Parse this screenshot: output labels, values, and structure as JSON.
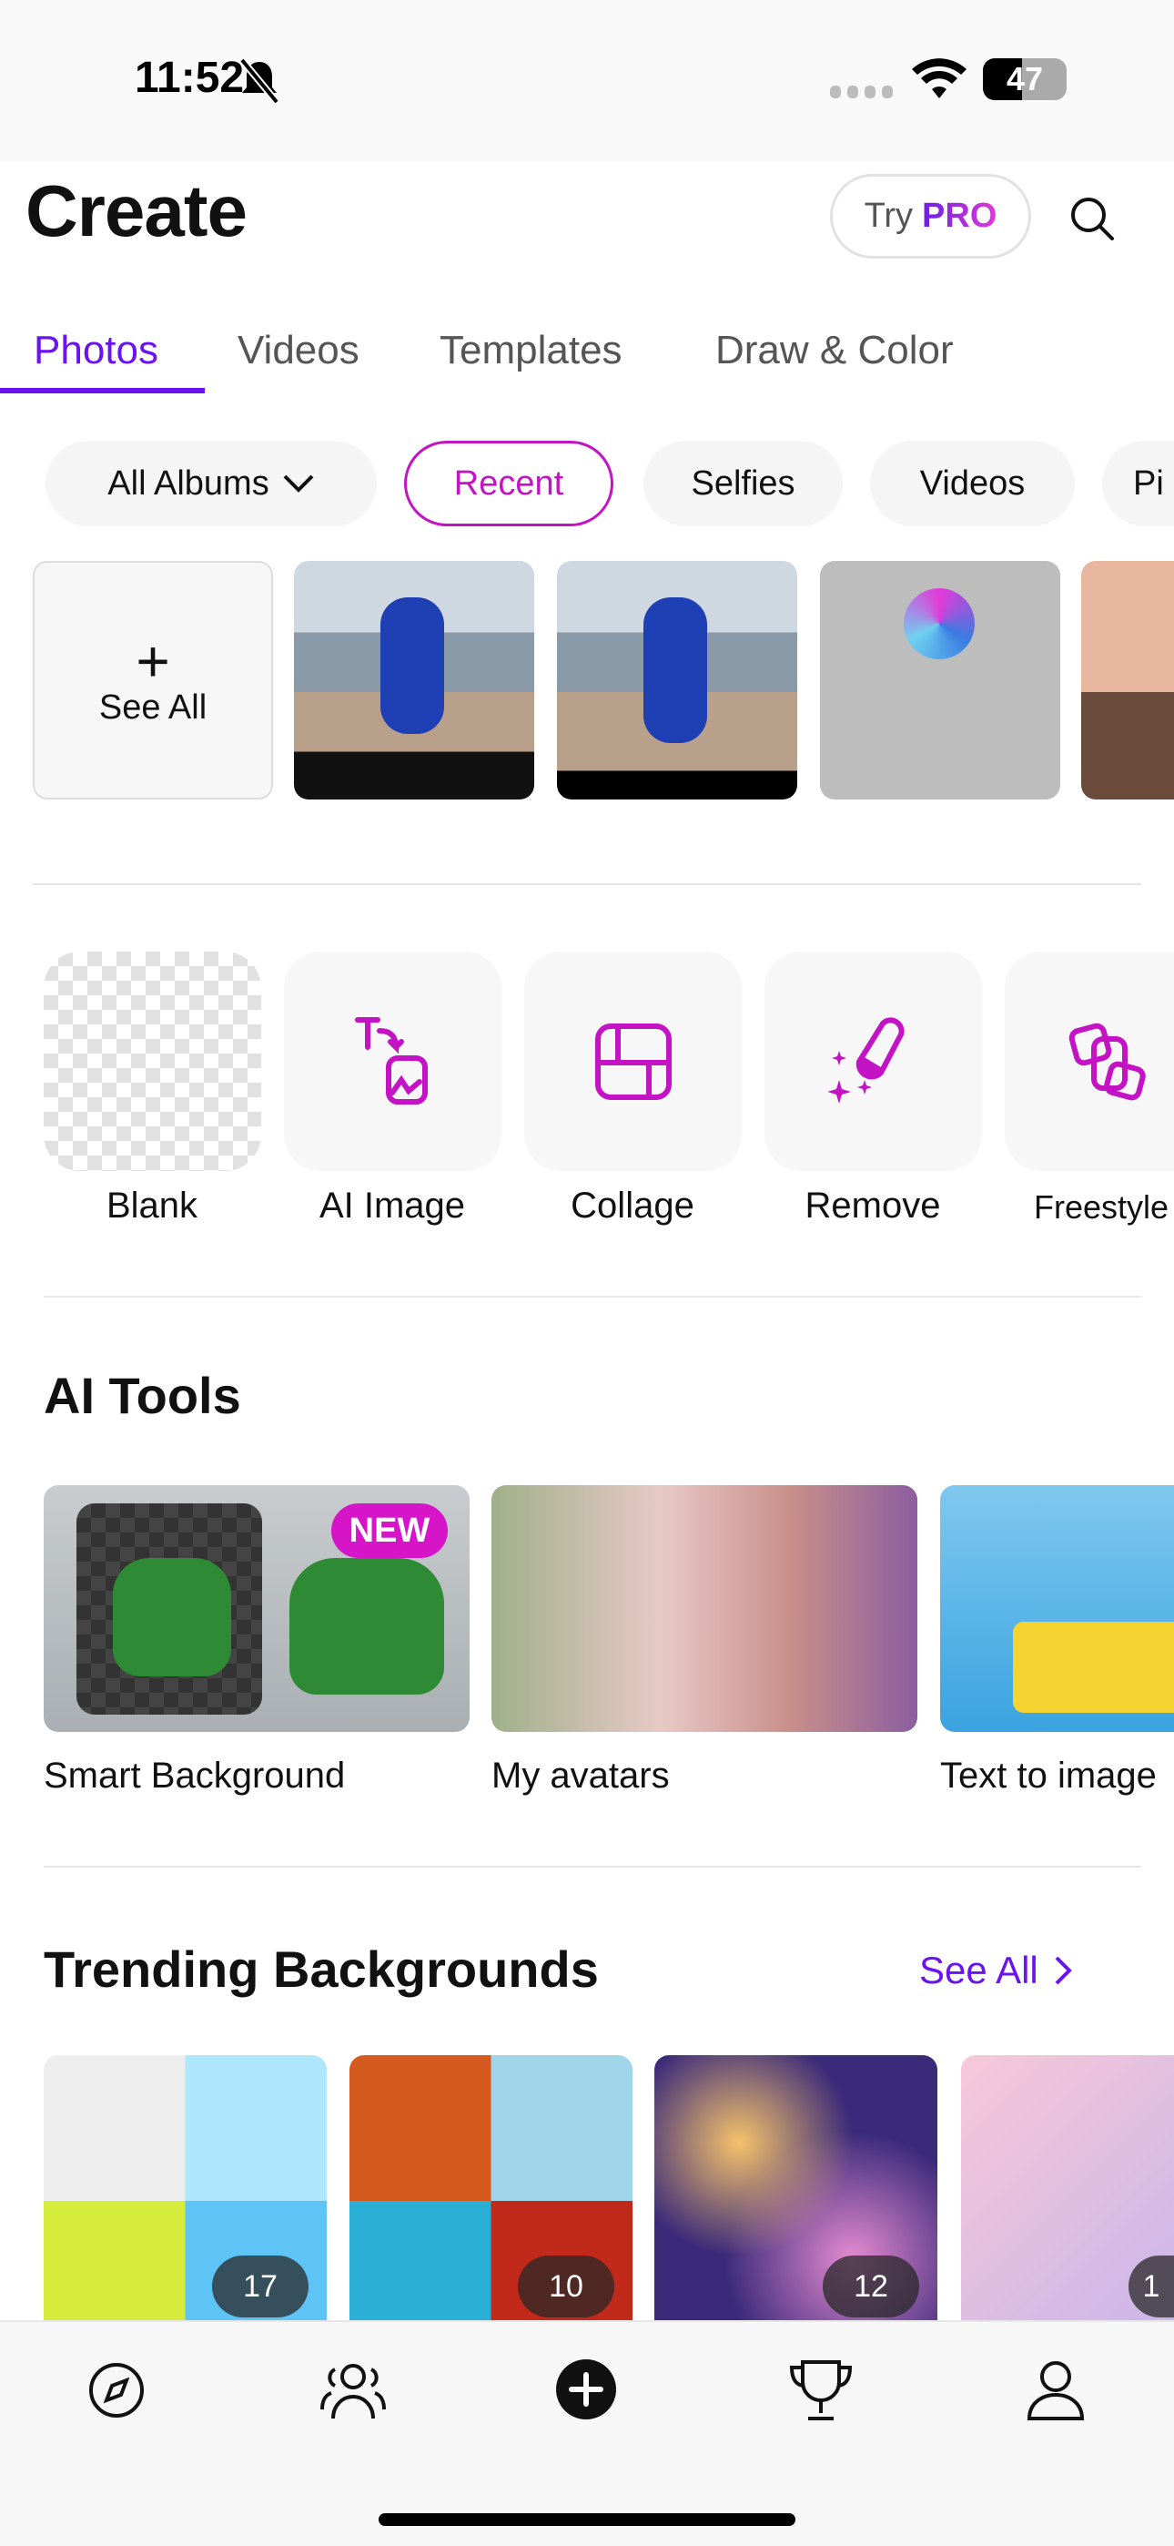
{
  "status": {
    "time": "11:52",
    "battery": "47"
  },
  "header": {
    "title": "Create",
    "try": "Try",
    "pro": "PRO"
  },
  "tabs": [
    "Photos",
    "Videos",
    "Templates",
    "Draw & Color"
  ],
  "chips": [
    "All Albums",
    "Recent",
    "Selfies",
    "Videos",
    "Pi"
  ],
  "recent": {
    "see_all": "See All"
  },
  "tools": [
    "Blank",
    "AI Image",
    "Collage",
    "Remove",
    "Freestyle"
  ],
  "ai_tools": {
    "title": "AI Tools",
    "items": [
      {
        "label": "Smart Background",
        "badge": "NEW"
      },
      {
        "label": "My avatars"
      },
      {
        "label": "Text to image"
      }
    ]
  },
  "trending": {
    "title": "Trending Backgrounds",
    "see_all": "See All",
    "counts": [
      "17",
      "10",
      "12",
      "1"
    ]
  },
  "colors": {
    "accent": "#6a12f0",
    "magenta": "#c413c4"
  }
}
